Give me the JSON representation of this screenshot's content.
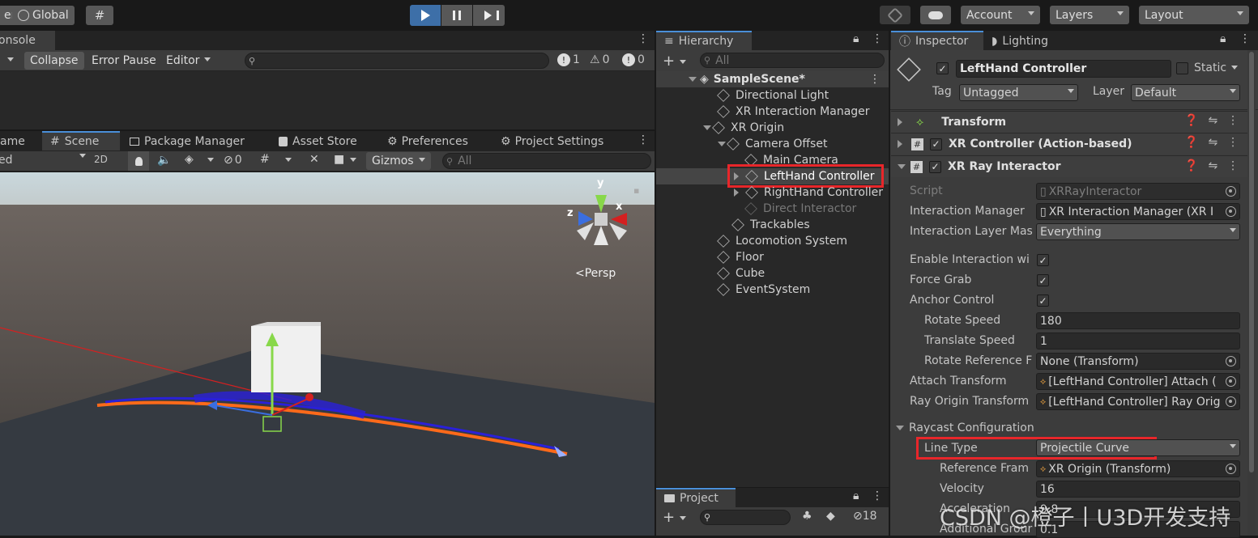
{
  "toolbar": {
    "pivot_partial": "er",
    "space": "Global",
    "account": "Account",
    "layers": "Layers",
    "layout": "Layout"
  },
  "console": {
    "tab": "onsole",
    "clear_partial": "",
    "collapse": "Collapse",
    "error_pause": "Error Pause",
    "editor": "Editor",
    "count_messages": "1",
    "count_warnings": "0",
    "count_errors": "0"
  },
  "scene_tabs": {
    "game_partial": "ame",
    "scene": "Scene",
    "package_manager": "Package Manager",
    "asset_store": "Asset Store",
    "preferences": "Preferences",
    "project_settings": "Project Settings"
  },
  "scene_toolbar": {
    "shading_partial": "ed",
    "mode2d": "2D",
    "hidden_count": "0",
    "gizmos": "Gizmos",
    "search_placeholder": "All"
  },
  "scene_view": {
    "persp": "<Persp",
    "axis_y": "y",
    "axis_x": "x",
    "axis_z": "z"
  },
  "hierarchy": {
    "title": "Hierarchy",
    "search_placeholder": "All",
    "scene": "SampleScene*",
    "items": [
      {
        "label": "Directional Light"
      },
      {
        "label": "XR Interaction Manager"
      },
      {
        "label": "XR Origin"
      },
      {
        "label": "Camera Offset"
      },
      {
        "label": "Main Camera"
      },
      {
        "label": "LeftHand Controller"
      },
      {
        "label": "RightHand Controller"
      },
      {
        "label": "Direct Interactor"
      },
      {
        "label": "Trackables"
      },
      {
        "label": "Locomotion System"
      },
      {
        "label": "Floor"
      },
      {
        "label": "Cube"
      },
      {
        "label": "EventSystem"
      }
    ]
  },
  "project": {
    "title": "Project",
    "hidden_count": "18"
  },
  "inspector": {
    "tab": "Inspector",
    "lighting_tab": "Lighting",
    "object_name": "LeftHand Controller",
    "static": "Static",
    "tag_label": "Tag",
    "tag": "Untagged",
    "layer_label": "Layer",
    "layer": "Default",
    "components": [
      "Transform",
      "XR Controller (Action-based)",
      "XR Ray Interactor"
    ],
    "fields": {
      "script": {
        "label": "Script",
        "value": "XRRayInteractor"
      },
      "interaction_manager": {
        "label": "Interaction Manager",
        "value": "XR Interaction Manager (XR I"
      },
      "interaction_layer": {
        "label": "Interaction Layer Mas",
        "value": "Everything"
      },
      "enable_interaction": {
        "label": "Enable Interaction wi"
      },
      "force_grab": {
        "label": "Force Grab"
      },
      "anchor_control": {
        "label": "Anchor Control"
      },
      "rotate_speed": {
        "label": "Rotate Speed",
        "value": "180"
      },
      "translate_speed": {
        "label": "Translate Speed",
        "value": "1"
      },
      "rotate_reference": {
        "label": "Rotate Reference F",
        "value": "None (Transform)"
      },
      "attach_transform": {
        "label": "Attach Transform",
        "value": "[LeftHand Controller] Attach ("
      },
      "ray_origin": {
        "label": "Ray Origin Transform",
        "value": "[LeftHand Controller] Ray Orig"
      },
      "raycast_config": {
        "label": "Raycast Configuration"
      },
      "line_type": {
        "label": "Line Type",
        "value": "Projectile Curve"
      },
      "reference_frame": {
        "label": "Reference Fram",
        "value": "XR Origin (Transform)"
      },
      "velocity": {
        "label": "Velocity",
        "value": "16"
      },
      "acceleration": {
        "label": "Acceleration",
        "value": "9.8"
      },
      "additional_ground": {
        "label": "Additional Grour",
        "value": "0.1"
      }
    }
  },
  "watermark": "CSDN @橙子丨U3D开发支持",
  "colors": {
    "highlight": "#e8262a",
    "selection": "#2c5d87",
    "play": "#3d6fa8"
  }
}
